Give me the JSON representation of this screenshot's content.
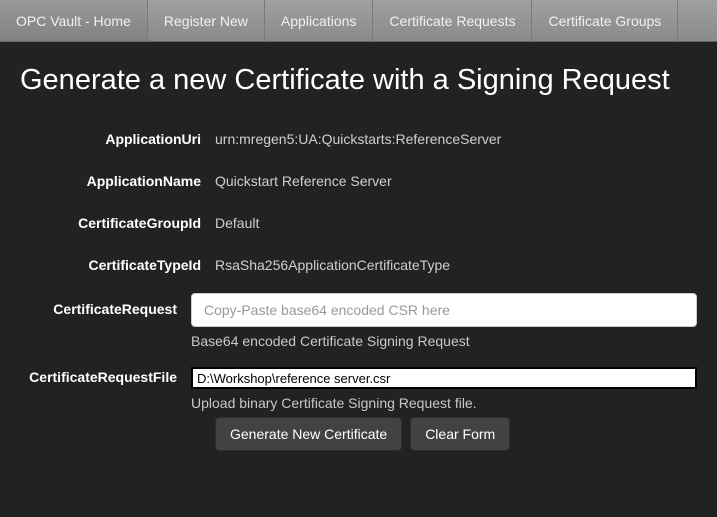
{
  "nav": {
    "items": [
      {
        "label": "OPC Vault - Home"
      },
      {
        "label": "Register New"
      },
      {
        "label": "Applications"
      },
      {
        "label": "Certificate Requests"
      },
      {
        "label": "Certificate Groups"
      }
    ]
  },
  "page": {
    "title": "Generate a new Certificate with a Signing Request"
  },
  "form": {
    "applicationUri": {
      "label": "ApplicationUri",
      "value": "urn:mregen5:UA:Quickstarts:ReferenceServer"
    },
    "applicationName": {
      "label": "ApplicationName",
      "value": "Quickstart Reference Server"
    },
    "certificateGroupId": {
      "label": "CertificateGroupId",
      "value": "Default"
    },
    "certificateTypeId": {
      "label": "CertificateTypeId",
      "value": "RsaSha256ApplicationCertificateType"
    },
    "certificateRequest": {
      "label": "CertificateRequest",
      "placeholder": "Copy-Paste base64 encoded CSR here",
      "help": "Base64 encoded Certificate Signing Request"
    },
    "certificateRequestFile": {
      "label": "CertificateRequestFile",
      "value": "D:\\Workshop\\reference server.csr",
      "help": "Upload binary Certificate Signing Request file."
    }
  },
  "buttons": {
    "generate": "Generate New Certificate",
    "clear": "Clear Form"
  }
}
